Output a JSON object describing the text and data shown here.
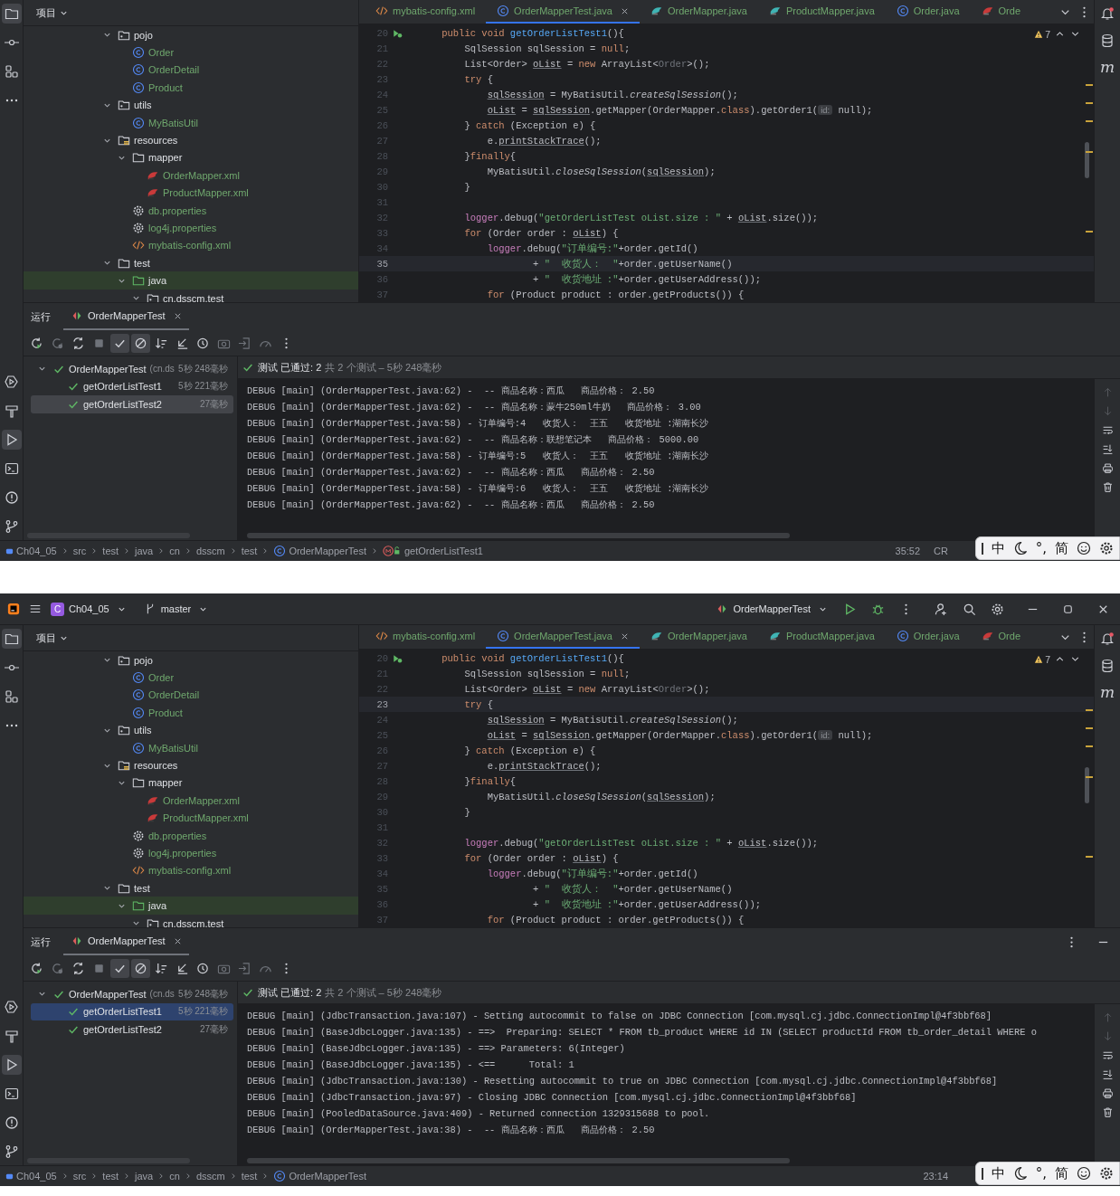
{
  "screens": [
    {
      "project_panel": {
        "title": "项目",
        "tree": [
          {
            "label": "pojo",
            "kind": "package",
            "expanded": true,
            "selected": false,
            "children": [
              {
                "label": "Order",
                "kind": "class",
                "selected": false
              },
              {
                "label": "OrderDetail",
                "kind": "class",
                "selected": false
              },
              {
                "label": "Product",
                "kind": "class",
                "selected": false
              }
            ]
          },
          {
            "label": "utils",
            "kind": "package",
            "expanded": true,
            "selected": false,
            "children": [
              {
                "label": "MyBatisUtil",
                "kind": "class",
                "selected": false
              }
            ]
          },
          {
            "label": "resources",
            "kind": "resources",
            "expanded": true,
            "selected": false,
            "children": [
              {
                "label": "mapper",
                "kind": "folder",
                "expanded": true,
                "selected": false,
                "children": [
                  {
                    "label": "OrderMapper.xml",
                    "kind": "mapper-xml",
                    "selected": false
                  },
                  {
                    "label": "ProductMapper.xml",
                    "kind": "mapper-xml",
                    "selected": false
                  }
                ]
              },
              {
                "label": "db.properties",
                "kind": "properties",
                "selected": false
              },
              {
                "label": "log4j.properties",
                "kind": "properties",
                "selected": false
              },
              {
                "label": "mybatis-config.xml",
                "kind": "config-xml",
                "selected": false
              }
            ]
          },
          {
            "label": "test",
            "kind": "folder",
            "expanded": true,
            "selected": false,
            "children": [
              {
                "label": "java",
                "kind": "test-root",
                "expanded": true,
                "selected": true,
                "children": [
                  {
                    "label": "cn.dsscm.test",
                    "kind": "package",
                    "expanded": true,
                    "selected": false
                  }
                ]
              }
            ]
          }
        ]
      },
      "editor": {
        "tabs": [
          {
            "label": "mybatis-config.xml",
            "kind": "config-xml",
            "selected": false
          },
          {
            "label": "OrderMapperTest.java",
            "kind": "class",
            "selected": true
          },
          {
            "label": "OrderMapper.java",
            "kind": "interface",
            "selected": false
          },
          {
            "label": "ProductMapper.java",
            "kind": "interface",
            "selected": false
          },
          {
            "label": "Order.java",
            "kind": "class",
            "selected": false
          },
          {
            "label": "Orde",
            "kind": "mapper-xml",
            "selected": false
          }
        ],
        "warning_count": "7",
        "lines": [
          {
            "number": "20",
            "current": false,
            "run_marker": true,
            "segments": [
              {
                "kind": "keyword",
                "text": "    public void "
              },
              {
                "kind": "method",
                "text": "getOrderListTest1"
              },
              {
                "kind": "plain",
                "text": "(){"
              }
            ]
          },
          {
            "number": "21",
            "current": false,
            "segments": [
              {
                "kind": "plain",
                "text": "        SqlSession sqlSession = "
              },
              {
                "kind": "keyword",
                "text": "null"
              },
              {
                "kind": "plain",
                "text": ";"
              }
            ]
          },
          {
            "number": "22",
            "current": false,
            "segments": [
              {
                "kind": "plain",
                "text": "        List<Order> "
              },
              {
                "kind": "underlined",
                "text": "oList"
              },
              {
                "kind": "plain",
                "text": " = "
              },
              {
                "kind": "keyword",
                "text": "new"
              },
              {
                "kind": "plain",
                "text": " ArrayList<"
              },
              {
                "kind": "generic",
                "text": "Order"
              },
              {
                "kind": "plain",
                "text": ">();"
              }
            ]
          },
          {
            "number": "23",
            "current": false,
            "segments": [
              {
                "kind": "keyword",
                "text": "        try"
              },
              {
                "kind": "plain",
                "text": " {"
              }
            ]
          },
          {
            "number": "24",
            "current": false,
            "segments": [
              {
                "kind": "underlined",
                "text": "            sqlSession"
              },
              {
                "kind": "plain",
                "text": " = MyBatisUtil."
              },
              {
                "kind": "italic",
                "text": "createSqlSession"
              },
              {
                "kind": "plain",
                "text": "();"
              }
            ]
          },
          {
            "number": "25",
            "current": false,
            "segments": [
              {
                "kind": "underlined",
                "text": "            oList"
              },
              {
                "kind": "plain",
                "text": " = "
              },
              {
                "kind": "underlined",
                "text": "sqlSession"
              },
              {
                "kind": "plain",
                "text": ".getMapper(OrderMapper."
              },
              {
                "kind": "keyword",
                "text": "class"
              },
              {
                "kind": "plain",
                "text": ").getOrder1("
              },
              {
                "kind": "hint",
                "text": "id:"
              },
              {
                "kind": "plain",
                "text": " null);"
              }
            ]
          },
          {
            "number": "26",
            "current": false,
            "segments": [
              {
                "kind": "plain",
                "text": "        } "
              },
              {
                "kind": "keyword",
                "text": "catch"
              },
              {
                "kind": "plain",
                "text": " (Exception e) {"
              }
            ]
          },
          {
            "number": "27",
            "current": false,
            "segments": [
              {
                "kind": "plain",
                "text": "            e."
              },
              {
                "kind": "underlined",
                "text": "printStackTrace"
              },
              {
                "kind": "plain",
                "text": "();"
              }
            ]
          },
          {
            "number": "28",
            "current": false,
            "segments": [
              {
                "kind": "plain",
                "text": "        }"
              },
              {
                "kind": "keyword",
                "text": "finally"
              },
              {
                "kind": "plain",
                "text": "{"
              }
            ]
          },
          {
            "number": "29",
            "current": false,
            "segments": [
              {
                "kind": "plain",
                "text": "            MyBatisUtil."
              },
              {
                "kind": "italic",
                "text": "closeSqlSession"
              },
              {
                "kind": "plain",
                "text": "("
              },
              {
                "kind": "underlined",
                "text": "sqlSession"
              },
              {
                "kind": "plain",
                "text": ");"
              }
            ]
          },
          {
            "number": "30",
            "current": false,
            "segments": [
              {
                "kind": "plain",
                "text": "        }"
              }
            ]
          },
          {
            "number": "31",
            "current": false
          },
          {
            "number": "32",
            "current": false,
            "segments": [
              {
                "kind": "field",
                "text": "        logger"
              },
              {
                "kind": "plain",
                "text": ".debug("
              },
              {
                "kind": "string",
                "text": "\"getOrderListTest oList.size : \""
              },
              {
                "kind": "plain",
                "text": " + "
              },
              {
                "kind": "underlined",
                "text": "oList"
              },
              {
                "kind": "plain",
                "text": ".size());"
              }
            ]
          },
          {
            "number": "33",
            "current": false,
            "segments": [
              {
                "kind": "keyword",
                "text": "        for"
              },
              {
                "kind": "plain",
                "text": " (Order order : "
              },
              {
                "kind": "underlined",
                "text": "oList"
              },
              {
                "kind": "plain",
                "text": ") {"
              }
            ]
          },
          {
            "number": "34",
            "current": false,
            "segments": [
              {
                "kind": "field",
                "text": "            logger"
              },
              {
                "kind": "plain",
                "text": ".debug("
              },
              {
                "kind": "string",
                "text": "\"订单编号:\""
              },
              {
                "kind": "plain",
                "text": "+order.getId()"
              }
            ]
          },
          {
            "number": "35",
            "current": true,
            "segments": [
              {
                "kind": "plain",
                "text": "                    + "
              },
              {
                "kind": "string",
                "text": "\"  收货人：  \""
              },
              {
                "kind": "plain",
                "text": "+order.getUserName()"
              }
            ]
          },
          {
            "number": "36",
            "current": false,
            "segments": [
              {
                "kind": "plain",
                "text": "                    + "
              },
              {
                "kind": "string",
                "text": "\"  收货地址 :\""
              },
              {
                "kind": "plain",
                "text": "+order.getUserAddress());"
              }
            ]
          },
          {
            "number": "37",
            "current": false,
            "segments": [
              {
                "kind": "keyword",
                "text": "            for"
              },
              {
                "kind": "plain",
                "text": " (Product product : order.getProducts()) {"
              }
            ]
          }
        ]
      },
      "right_strip": {
        "maven_label": "m"
      },
      "run_panel": {
        "title": "运行",
        "tab": "OrderMapperTest",
        "options_visible": false,
        "focused": false,
        "toggles": [
          {
            "on": true
          },
          {
            "on": true
          }
        ],
        "tests": {
          "name": "OrderMapperTest",
          "package": "(cn.ds",
          "time": "5秒 248毫秒",
          "expanded": true,
          "selected": false,
          "children": [
            {
              "name": "getOrderListTest1",
              "time": "5秒 221毫秒",
              "selected": false
            },
            {
              "name": "getOrderListTest2",
              "time": "27毫秒",
              "selected": true
            }
          ]
        },
        "summary": {
          "status": "测试 已通过: 2",
          "detail": "共 2 个测试 – 5秒 248毫秒"
        },
        "console": [
          "DEBUG [main] (OrderMapperTest.java:62) -  -- 商品名称：西瓜   商品价格： 2.50",
          "DEBUG [main] (OrderMapperTest.java:62) -  -- 商品名称：蒙牛250ml牛奶   商品价格： 3.00",
          "DEBUG [main] (OrderMapperTest.java:58) - 订单编号:4   收货人：  王五   收货地址 :湖南长沙",
          "DEBUG [main] (OrderMapperTest.java:62) -  -- 商品名称：联想笔记本   商品价格： 5000.00",
          "DEBUG [main] (OrderMapperTest.java:58) - 订单编号:5   收货人：  王五   收货地址 :湖南长沙",
          "DEBUG [main] (OrderMapperTest.java:62) -  -- 商品名称：西瓜   商品价格： 2.50",
          "DEBUG [main] (OrderMapperTest.java:58) - 订单编号:6   收货人：  王五   收货地址 :湖南长沙",
          "DEBUG [main] (OrderMapperTest.java:62) -  -- 商品名称：西瓜   商品价格： 2.50"
        ]
      },
      "status_bar": {
        "breadcrumb": [
          {
            "label": "Ch04_05",
            "kind": "module"
          },
          {
            "label": "src",
            "kind": "folder"
          },
          {
            "label": "test",
            "kind": "folder"
          },
          {
            "label": "java",
            "kind": "folder"
          },
          {
            "label": "cn",
            "kind": "folder"
          },
          {
            "label": "dsscm",
            "kind": "folder"
          },
          {
            "label": "test",
            "kind": "folder"
          },
          {
            "label": "OrderMapperTest",
            "kind": "class"
          },
          {
            "label": "getOrderListTest1",
            "kind": "method"
          }
        ],
        "position": "35:52",
        "line_ending": "CR"
      },
      "ime_bar": [
        {
          "kind": "text",
          "label": "中"
        },
        {
          "kind": "moon"
        },
        {
          "kind": "text",
          "label": "°,"
        },
        {
          "kind": "text",
          "label": "简"
        },
        {
          "kind": "smiley"
        },
        {
          "kind": "settings"
        }
      ]
    },
    {
      "title_bar": {
        "project_badge": "C",
        "project": "Ch04_05",
        "branch": "master",
        "run_config": "OrderMapperTest"
      },
      "project_panel": {
        "title": "项目",
        "tree": [
          {
            "label": "pojo",
            "kind": "package",
            "expanded": true,
            "selected": false,
            "children": [
              {
                "label": "Order",
                "kind": "class",
                "selected": false
              },
              {
                "label": "OrderDetail",
                "kind": "class",
                "selected": false
              },
              {
                "label": "Product",
                "kind": "class",
                "selected": false
              }
            ]
          },
          {
            "label": "utils",
            "kind": "package",
            "expanded": true,
            "selected": false,
            "children": [
              {
                "label": "MyBatisUtil",
                "kind": "class",
                "selected": false
              }
            ]
          },
          {
            "label": "resources",
            "kind": "resources",
            "expanded": true,
            "selected": false,
            "children": [
              {
                "label": "mapper",
                "kind": "folder",
                "expanded": true,
                "selected": false,
                "children": [
                  {
                    "label": "OrderMapper.xml",
                    "kind": "mapper-xml",
                    "selected": false
                  },
                  {
                    "label": "ProductMapper.xml",
                    "kind": "mapper-xml",
                    "selected": false
                  }
                ]
              },
              {
                "label": "db.properties",
                "kind": "properties",
                "selected": false
              },
              {
                "label": "log4j.properties",
                "kind": "properties",
                "selected": false
              },
              {
                "label": "mybatis-config.xml",
                "kind": "config-xml",
                "selected": false
              }
            ]
          },
          {
            "label": "test",
            "kind": "folder",
            "expanded": true,
            "selected": false,
            "children": [
              {
                "label": "java",
                "kind": "test-root",
                "expanded": true,
                "selected": true,
                "children": [
                  {
                    "label": "cn.dsscm.test",
                    "kind": "package",
                    "expanded": true,
                    "selected": false
                  }
                ]
              }
            ]
          }
        ]
      },
      "editor": {
        "tabs": [
          {
            "label": "mybatis-config.xml",
            "kind": "config-xml",
            "selected": false
          },
          {
            "label": "OrderMapperTest.java",
            "kind": "class",
            "selected": true
          },
          {
            "label": "OrderMapper.java",
            "kind": "interface",
            "selected": false
          },
          {
            "label": "ProductMapper.java",
            "kind": "interface",
            "selected": false
          },
          {
            "label": "Order.java",
            "kind": "class",
            "selected": false
          },
          {
            "label": "Orde",
            "kind": "mapper-xml",
            "selected": false
          }
        ],
        "warning_count": "7",
        "lines": [
          {
            "number": "20",
            "current": false,
            "run_marker": true,
            "segments": [
              {
                "kind": "keyword",
                "text": "    public void "
              },
              {
                "kind": "method",
                "text": "getOrderListTest1"
              },
              {
                "kind": "plain",
                "text": "(){"
              }
            ]
          },
          {
            "number": "21",
            "current": false,
            "segments": [
              {
                "kind": "plain",
                "text": "        SqlSession sqlSession = "
              },
              {
                "kind": "keyword",
                "text": "null"
              },
              {
                "kind": "plain",
                "text": ";"
              }
            ]
          },
          {
            "number": "22",
            "current": false,
            "segments": [
              {
                "kind": "plain",
                "text": "        List<Order> "
              },
              {
                "kind": "underlined",
                "text": "oList"
              },
              {
                "kind": "plain",
                "text": " = "
              },
              {
                "kind": "keyword",
                "text": "new"
              },
              {
                "kind": "plain",
                "text": " ArrayList<"
              },
              {
                "kind": "generic",
                "text": "Order"
              },
              {
                "kind": "plain",
                "text": ">();"
              }
            ]
          },
          {
            "number": "23",
            "current": true,
            "segments": [
              {
                "kind": "keyword",
                "text": "        try"
              },
              {
                "kind": "plain",
                "text": " {"
              }
            ]
          },
          {
            "number": "24",
            "current": false,
            "segments": [
              {
                "kind": "underlined",
                "text": "            sqlSession"
              },
              {
                "kind": "plain",
                "text": " = MyBatisUtil."
              },
              {
                "kind": "italic",
                "text": "createSqlSession"
              },
              {
                "kind": "plain",
                "text": "();"
              }
            ]
          },
          {
            "number": "25",
            "current": false,
            "segments": [
              {
                "kind": "underlined",
                "text": "            oList"
              },
              {
                "kind": "plain",
                "text": " = "
              },
              {
                "kind": "underlined",
                "text": "sqlSession"
              },
              {
                "kind": "plain",
                "text": ".getMapper(OrderMapper."
              },
              {
                "kind": "keyword",
                "text": "class"
              },
              {
                "kind": "plain",
                "text": ").getOrder1("
              },
              {
                "kind": "hint",
                "text": "id:"
              },
              {
                "kind": "plain",
                "text": " null);"
              }
            ]
          },
          {
            "number": "26",
            "current": false,
            "segments": [
              {
                "kind": "plain",
                "text": "        } "
              },
              {
                "kind": "keyword",
                "text": "catch"
              },
              {
                "kind": "plain",
                "text": " (Exception e) {"
              }
            ]
          },
          {
            "number": "27",
            "current": false,
            "segments": [
              {
                "kind": "plain",
                "text": "            e."
              },
              {
                "kind": "underlined",
                "text": "printStackTrace"
              },
              {
                "kind": "plain",
                "text": "();"
              }
            ]
          },
          {
            "number": "28",
            "current": false,
            "segments": [
              {
                "kind": "plain",
                "text": "        }"
              },
              {
                "kind": "keyword",
                "text": "finally"
              },
              {
                "kind": "plain",
                "text": "{"
              }
            ]
          },
          {
            "number": "29",
            "current": false,
            "segments": [
              {
                "kind": "plain",
                "text": "            MyBatisUtil."
              },
              {
                "kind": "italic",
                "text": "closeSqlSession"
              },
              {
                "kind": "plain",
                "text": "("
              },
              {
                "kind": "underlined",
                "text": "sqlSession"
              },
              {
                "kind": "plain",
                "text": ");"
              }
            ]
          },
          {
            "number": "30",
            "current": false,
            "segments": [
              {
                "kind": "plain",
                "text": "        }"
              }
            ]
          },
          {
            "number": "31",
            "current": false
          },
          {
            "number": "32",
            "current": false,
            "segments": [
              {
                "kind": "field",
                "text": "        logger"
              },
              {
                "kind": "plain",
                "text": ".debug("
              },
              {
                "kind": "string",
                "text": "\"getOrderListTest oList.size : \""
              },
              {
                "kind": "plain",
                "text": " + "
              },
              {
                "kind": "underlined",
                "text": "oList"
              },
              {
                "kind": "plain",
                "text": ".size());"
              }
            ]
          },
          {
            "number": "33",
            "current": false,
            "segments": [
              {
                "kind": "keyword",
                "text": "        for"
              },
              {
                "kind": "plain",
                "text": " (Order order : "
              },
              {
                "kind": "underlined",
                "text": "oList"
              },
              {
                "kind": "plain",
                "text": ") {"
              }
            ]
          },
          {
            "number": "34",
            "current": false,
            "segments": [
              {
                "kind": "field",
                "text": "            logger"
              },
              {
                "kind": "plain",
                "text": ".debug("
              },
              {
                "kind": "string",
                "text": "\"订单编号:\""
              },
              {
                "kind": "plain",
                "text": "+order.getId()"
              }
            ]
          },
          {
            "number": "35",
            "current": false,
            "segments": [
              {
                "kind": "plain",
                "text": "                    + "
              },
              {
                "kind": "string",
                "text": "\"  收货人：  \""
              },
              {
                "kind": "plain",
                "text": "+order.getUserName()"
              }
            ]
          },
          {
            "number": "36",
            "current": false,
            "segments": [
              {
                "kind": "plain",
                "text": "                    + "
              },
              {
                "kind": "string",
                "text": "\"  收货地址 :\""
              },
              {
                "kind": "plain",
                "text": "+order.getUserAddress());"
              }
            ]
          },
          {
            "number": "37",
            "current": false,
            "segments": [
              {
                "kind": "keyword",
                "text": "            for"
              },
              {
                "kind": "plain",
                "text": " (Product product : order.getProducts()) {"
              }
            ]
          }
        ]
      },
      "right_strip": {
        "maven_label": "m"
      },
      "run_panel": {
        "title": "运行",
        "tab": "OrderMapperTest",
        "options_visible": true,
        "focused": true,
        "toggles": [
          {
            "on": true
          },
          {
            "on": true
          }
        ],
        "tests": {
          "name": "OrderMapperTest",
          "package": "(cn.ds",
          "time": "5秒 248毫秒",
          "expanded": true,
          "selected": false,
          "children": [
            {
              "name": "getOrderListTest1",
              "time": "5秒 221毫秒",
              "selected": true
            },
            {
              "name": "getOrderListTest2",
              "time": "27毫秒",
              "selected": false
            }
          ]
        },
        "summary": {
          "status": "测试 已通过: 2",
          "detail": "共 2 个测试 – 5秒 248毫秒"
        },
        "console": [
          "DEBUG [main] (JdbcTransaction.java:107) - Setting autocommit to false on JDBC Connection [com.mysql.cj.jdbc.ConnectionImpl@4f3bbf68]",
          "DEBUG [main] (BaseJdbcLogger.java:135) - ==>  Preparing: SELECT * FROM tb_product WHERE id IN (SELECT productId FROM tb_order_detail WHERE o",
          "DEBUG [main] (BaseJdbcLogger.java:135) - ==> Parameters: 6(Integer)",
          "DEBUG [main] (BaseJdbcLogger.java:135) - <==      Total: 1",
          "DEBUG [main] (JdbcTransaction.java:130) - Resetting autocommit to true on JDBC Connection [com.mysql.cj.jdbc.ConnectionImpl@4f3bbf68]",
          "DEBUG [main] (JdbcTransaction.java:97) - Closing JDBC Connection [com.mysql.cj.jdbc.ConnectionImpl@4f3bbf68]",
          "DEBUG [main] (PooledDataSource.java:409) - Returned connection 1329315688 to pool.",
          "DEBUG [main] (OrderMapperTest.java:38) -  -- 商品名称：西瓜   商品价格： 2.50"
        ]
      },
      "status_bar": {
        "breadcrumb": [
          {
            "label": "Ch04_05",
            "kind": "module"
          },
          {
            "label": "src",
            "kind": "folder"
          },
          {
            "label": "test",
            "kind": "folder"
          },
          {
            "label": "java",
            "kind": "folder"
          },
          {
            "label": "cn",
            "kind": "folder"
          },
          {
            "label": "dsscm",
            "kind": "folder"
          },
          {
            "label": "test",
            "kind": "folder"
          },
          {
            "label": "OrderMapperTest",
            "kind": "class"
          }
        ],
        "position": "23:14"
      },
      "ime_bar": [
        {
          "kind": "text",
          "label": "中"
        },
        {
          "kind": "moon"
        },
        {
          "kind": "text",
          "label": "°,"
        },
        {
          "kind": "text",
          "label": "简"
        },
        {
          "kind": "smiley"
        },
        {
          "kind": "settings"
        }
      ]
    }
  ]
}
